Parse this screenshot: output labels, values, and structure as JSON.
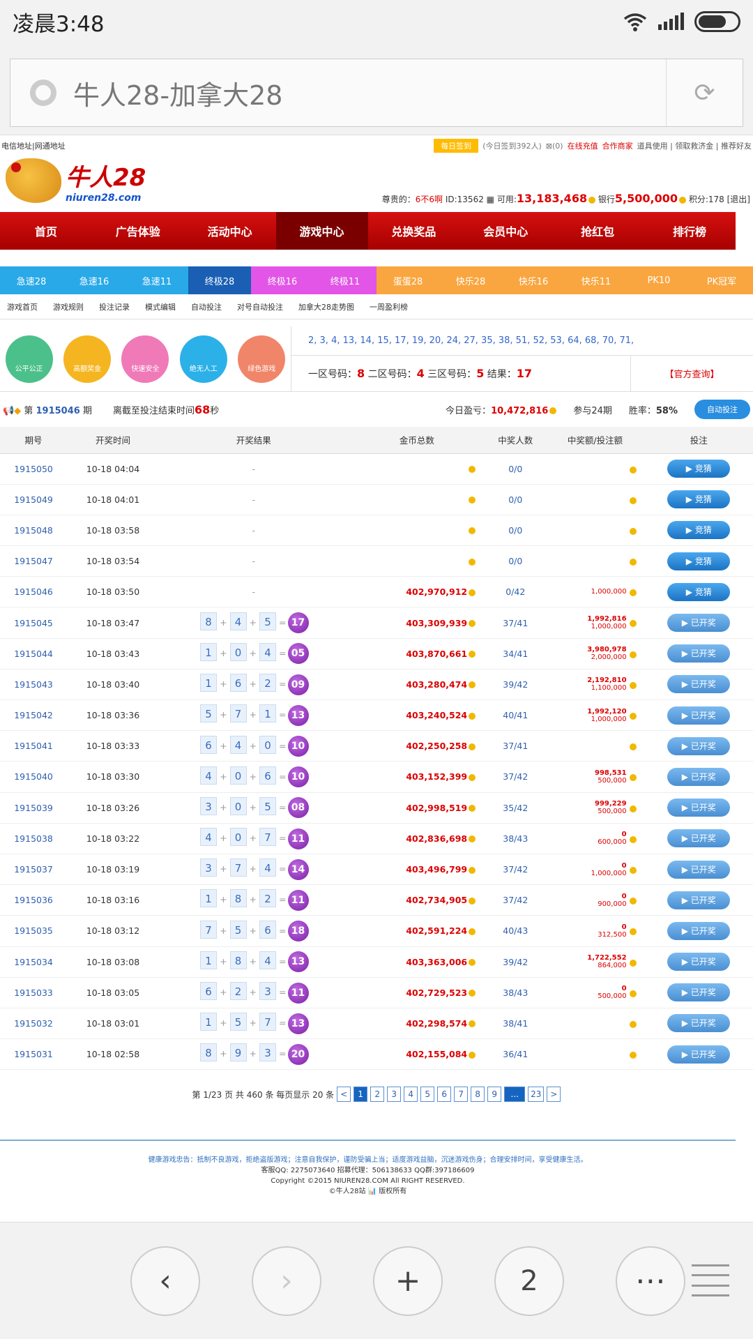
{
  "status": {
    "time": "凌晨3:48"
  },
  "browser": {
    "title": "牛人28-加拿大28",
    "tab_count": "2"
  },
  "topbar": {
    "left": "电信地址|网通地址",
    "sign": "每日签到",
    "signed": "(今日签到392人)",
    "msg": "⊠(0)",
    "recharge": "在线充值",
    "merchant": "合作商家",
    "links": "道具使用 | 领取救济金 | 推荐好友"
  },
  "logo": {
    "cn": "牛人28",
    "en": "niuren28.com"
  },
  "user": {
    "prefix": "尊贵的：",
    "name": "6不6啊",
    "id": "ID:13562",
    "avail_label": "可用:",
    "avail": "13,183,468",
    "bank_label": "银行",
    "bank": "5,500,000",
    "points": "积分:178",
    "exit": "[退出]"
  },
  "nav": [
    "首页",
    "广告体验",
    "活动中心",
    "游戏中心",
    "兑换奖品",
    "会员中心",
    "抢红包",
    "排行榜"
  ],
  "game_tabs": [
    {
      "label": "急速28",
      "color": "#29a9e8"
    },
    {
      "label": "急速16",
      "color": "#29a9e8"
    },
    {
      "label": "急速11",
      "color": "#29a9e8"
    },
    {
      "label": "终极28",
      "color": "#1a5fb4"
    },
    {
      "label": "终极16",
      "color": "#e255e6"
    },
    {
      "label": "终极11",
      "color": "#e255e6"
    },
    {
      "label": "蛋蛋28",
      "color": "#f9a640"
    },
    {
      "label": "快乐28",
      "color": "#f9a640"
    },
    {
      "label": "快乐16",
      "color": "#f9a640"
    },
    {
      "label": "快乐11",
      "color": "#f9a640"
    },
    {
      "label": "PK10",
      "color": "#f9a640"
    },
    {
      "label": "PK冠军",
      "color": "#f9a640"
    }
  ],
  "sub_nav": [
    "游戏首页",
    "游戏规则",
    "投注记录",
    "模式编辑",
    "自动投注",
    "对号自动投注",
    "加拿大28走势图",
    "一周盈利榜"
  ],
  "features": [
    {
      "label": "公平公正",
      "color": "#4cc08a"
    },
    {
      "label": "高额奖金",
      "color": "#f5b520"
    },
    {
      "label": "快速安全",
      "color": "#f07ab8"
    },
    {
      "label": "绝无人工",
      "color": "#2cb0e8"
    },
    {
      "label": "绿色游戏",
      "color": "#f0856a"
    }
  ],
  "numbers": "2, 3, 4, 13, 14, 15, 17, 19, 20, 24, 27, 35, 38, 51, 52, 53, 64, 68, 70, 71,",
  "zones": {
    "z1_label": "一区号码：",
    "z1": "8",
    "z2_label": "二区号码：",
    "z2": "4",
    "z3_label": "三区号码：",
    "z3": "5",
    "res_label": "结果：",
    "res": "17",
    "query": "【官方查询】"
  },
  "period": {
    "prefix": "第",
    "id": "1915046",
    "suffix": "期",
    "countdown_label": "离截至投注结束时间",
    "seconds": "68",
    "sec_unit": "秒",
    "today_label": "今日盈亏：",
    "today": "10,472,816",
    "joined": "参与24期",
    "rate_label": "胜率：",
    "rate": "58%",
    "auto": "自动投注"
  },
  "table": {
    "headers": [
      "期号",
      "开奖时间",
      "开奖结果",
      "金币总数",
      "中奖人数",
      "中奖额/投注额",
      "投注"
    ],
    "rows": [
      {
        "id": "1915050",
        "time": "10-18 04:04",
        "result": null,
        "total": "",
        "winners": "0/0",
        "bonus": "",
        "bet": "",
        "btn": "竞猜",
        "done": false
      },
      {
        "id": "1915049",
        "time": "10-18 04:01",
        "result": null,
        "total": "",
        "winners": "0/0",
        "bonus": "",
        "bet": "",
        "btn": "竞猜",
        "done": false
      },
      {
        "id": "1915048",
        "time": "10-18 03:58",
        "result": null,
        "total": "",
        "winners": "0/0",
        "bonus": "",
        "bet": "",
        "btn": "竞猜",
        "done": false
      },
      {
        "id": "1915047",
        "time": "10-18 03:54",
        "result": null,
        "total": "",
        "winners": "0/0",
        "bonus": "",
        "bet": "",
        "btn": "竞猜",
        "done": false
      },
      {
        "id": "1915046",
        "time": "10-18 03:50",
        "result": null,
        "total": "402,970,912",
        "winners": "0/42",
        "bonus": "",
        "bet": "1,000,000",
        "btn": "竞猜",
        "done": false
      },
      {
        "id": "1915045",
        "time": "10-18 03:47",
        "result": [
          "8",
          "4",
          "5",
          "17"
        ],
        "total": "403,309,939",
        "winners": "37/41",
        "bonus": "1,992,816",
        "bet": "1,000,000",
        "btn": "已开奖",
        "done": true
      },
      {
        "id": "1915044",
        "time": "10-18 03:43",
        "result": [
          "1",
          "0",
          "4",
          "05"
        ],
        "total": "403,870,661",
        "winners": "34/41",
        "bonus": "3,980,978",
        "bet": "2,000,000",
        "btn": "已开奖",
        "done": true
      },
      {
        "id": "1915043",
        "time": "10-18 03:40",
        "result": [
          "1",
          "6",
          "2",
          "09"
        ],
        "total": "403,280,474",
        "winners": "39/42",
        "bonus": "2,192,810",
        "bet": "1,100,000",
        "btn": "已开奖",
        "done": true
      },
      {
        "id": "1915042",
        "time": "10-18 03:36",
        "result": [
          "5",
          "7",
          "1",
          "13"
        ],
        "total": "403,240,524",
        "winners": "40/41",
        "bonus": "1,992,120",
        "bet": "1,000,000",
        "btn": "已开奖",
        "done": true
      },
      {
        "id": "1915041",
        "time": "10-18 03:33",
        "result": [
          "6",
          "4",
          "0",
          "10"
        ],
        "total": "402,250,258",
        "winners": "37/41",
        "bonus": "",
        "bet": "",
        "btn": "已开奖",
        "done": true
      },
      {
        "id": "1915040",
        "time": "10-18 03:30",
        "result": [
          "4",
          "0",
          "6",
          "10"
        ],
        "total": "403,152,399",
        "winners": "37/42",
        "bonus": "998,531",
        "bet": "500,000",
        "btn": "已开奖",
        "done": true
      },
      {
        "id": "1915039",
        "time": "10-18 03:26",
        "result": [
          "3",
          "0",
          "5",
          "08"
        ],
        "total": "402,998,519",
        "winners": "35/42",
        "bonus": "999,229",
        "bet": "500,000",
        "btn": "已开奖",
        "done": true
      },
      {
        "id": "1915038",
        "time": "10-18 03:22",
        "result": [
          "4",
          "0",
          "7",
          "11"
        ],
        "total": "402,836,698",
        "winners": "38/43",
        "bonus": "0",
        "bet": "600,000",
        "btn": "已开奖",
        "done": true
      },
      {
        "id": "1915037",
        "time": "10-18 03:19",
        "result": [
          "3",
          "7",
          "4",
          "14"
        ],
        "total": "403,496,799",
        "winners": "37/42",
        "bonus": "0",
        "bet": "1,000,000",
        "btn": "已开奖",
        "done": true
      },
      {
        "id": "1915036",
        "time": "10-18 03:16",
        "result": [
          "1",
          "8",
          "2",
          "11"
        ],
        "total": "402,734,905",
        "winners": "37/42",
        "bonus": "0",
        "bet": "900,000",
        "btn": "已开奖",
        "done": true
      },
      {
        "id": "1915035",
        "time": "10-18 03:12",
        "result": [
          "7",
          "5",
          "6",
          "18"
        ],
        "total": "402,591,224",
        "winners": "40/43",
        "bonus": "0",
        "bet": "312,500",
        "btn": "已开奖",
        "done": true
      },
      {
        "id": "1915034",
        "time": "10-18 03:08",
        "result": [
          "1",
          "8",
          "4",
          "13"
        ],
        "total": "403,363,006",
        "winners": "39/42",
        "bonus": "1,722,552",
        "bet": "864,000",
        "btn": "已开奖",
        "done": true
      },
      {
        "id": "1915033",
        "time": "10-18 03:05",
        "result": [
          "6",
          "2",
          "3",
          "11"
        ],
        "total": "402,729,523",
        "winners": "38/43",
        "bonus": "0",
        "bet": "500,000",
        "btn": "已开奖",
        "done": true
      },
      {
        "id": "1915032",
        "time": "10-18 03:01",
        "result": [
          "1",
          "5",
          "7",
          "13"
        ],
        "total": "402,298,574",
        "winners": "38/41",
        "bonus": "",
        "bet": "",
        "btn": "已开奖",
        "done": true
      },
      {
        "id": "1915031",
        "time": "10-18 02:58",
        "result": [
          "8",
          "9",
          "3",
          "20"
        ],
        "total": "402,155,084",
        "winners": "36/41",
        "bonus": "",
        "bet": "",
        "btn": "已开奖",
        "done": true
      }
    ]
  },
  "pager": {
    "info": "第 1/23 页 共 460 条 每页显示 20 条",
    "prev": "<",
    "pages": [
      "1",
      "2",
      "3",
      "4",
      "5",
      "6",
      "7",
      "8",
      "9"
    ],
    "dots": "...",
    "last": "23",
    "next": ">"
  },
  "footer": {
    "tip": "健康游戏忠告：抵制不良游戏，拒绝盗版游戏；注意自我保护，谨防受骗上当；适度游戏益脑，沉迷游戏伤身；合理安排时间，享受健康生活。",
    "contact": "客服QQ: 2275073640 招募代理：506138633 QQ群:397186609",
    "copyright": "Copyright ©2015 NIUREN28.COM All RIGHT RESERVED.",
    "rights": "©牛人28站 📊 版权所有"
  }
}
